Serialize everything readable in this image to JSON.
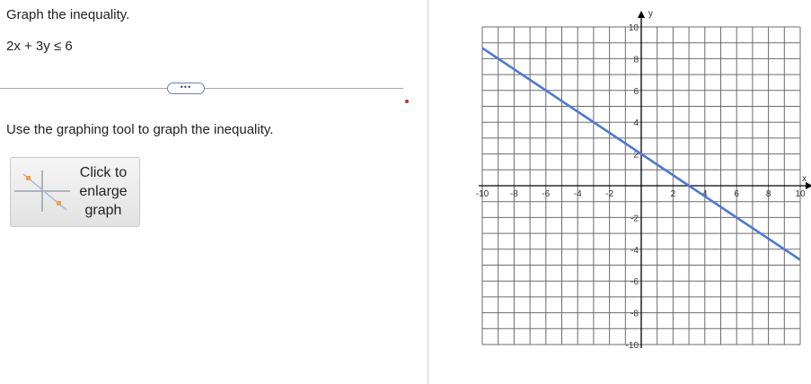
{
  "question": {
    "title": "Graph the inequality.",
    "inequality": "2x + 3y ≤ 6",
    "more_button": "•••",
    "instruction": "Use the graphing tool to graph the inequality."
  },
  "enlarge_button": {
    "label": "Click to enlarge graph",
    "icon": "graph-thumbnail-icon"
  },
  "colors": {
    "line": "#4a78d6",
    "grid": "#6b6b6b",
    "accent_red": "#dd2222"
  },
  "chart_data": {
    "type": "line",
    "xlim": [
      -10,
      10
    ],
    "ylim": [
      -10,
      10
    ],
    "grid": true,
    "x_axis_label": "x",
    "y_axis_label": "y",
    "x_tick_labels": [
      "-10",
      "-8",
      "-6",
      "-4",
      "-2",
      "2",
      "4",
      "6",
      "8",
      "10"
    ],
    "y_tick_labels": [
      "10",
      "8",
      "6",
      "4",
      "2",
      "-2",
      "-4",
      "-6",
      "-8",
      "-10"
    ],
    "series": [
      {
        "x": [
          -10,
          10
        ],
        "y": [
          8.67,
          -4.67
        ]
      }
    ]
  }
}
